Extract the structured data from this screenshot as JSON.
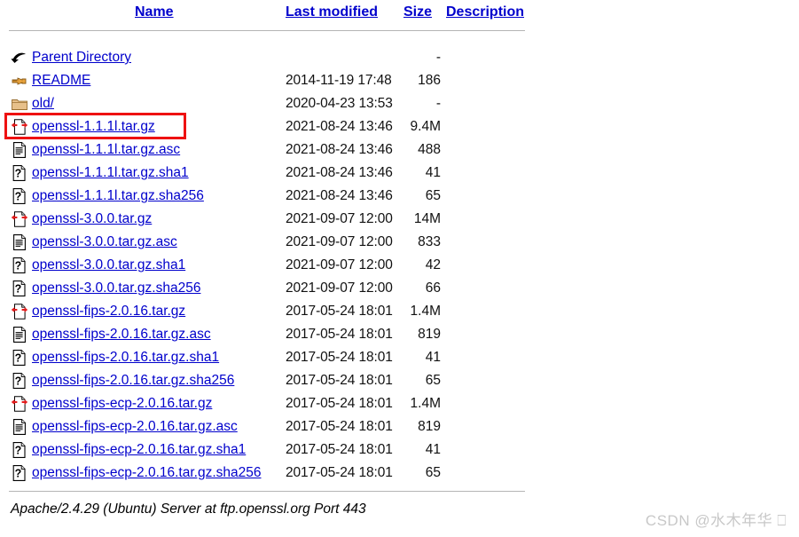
{
  "page": {
    "background": "#ffffff",
    "link_color": "#0000cc",
    "highlight_color": "#ee1111"
  },
  "table": {
    "headers": [
      {
        "label": "Name",
        "name": "column-header-name"
      },
      {
        "label": "Last modified",
        "name": "column-header-last-modified"
      },
      {
        "label": "Size",
        "name": "column-header-size"
      },
      {
        "label": "Description",
        "name": "column-header-description"
      }
    ],
    "rows": [
      {
        "icon": "back-arrow-icon",
        "name": "Parent Directory",
        "modified": "",
        "size": "-",
        "description": ""
      },
      {
        "icon": "hand-pointing-icon",
        "name": "README",
        "modified": "2014-11-19 17:48",
        "size": "186",
        "description": ""
      },
      {
        "icon": "folder-icon",
        "name": "old/",
        "modified": "2020-04-23 13:53",
        "size": "-",
        "description": ""
      },
      {
        "icon": "compressed-icon",
        "name": "openssl-1.1.1l.tar.gz",
        "modified": "2021-08-24 13:46",
        "size": "9.4M",
        "description": "",
        "highlighted": true
      },
      {
        "icon": "text-file-icon",
        "name": "openssl-1.1.1l.tar.gz.asc",
        "modified": "2021-08-24 13:46",
        "size": "488",
        "description": ""
      },
      {
        "icon": "unknown-file-icon",
        "name": "openssl-1.1.1l.tar.gz.sha1",
        "modified": "2021-08-24 13:46",
        "size": "41",
        "description": ""
      },
      {
        "icon": "unknown-file-icon",
        "name": "openssl-1.1.1l.tar.gz.sha256",
        "modified": "2021-08-24 13:46",
        "size": "65",
        "description": ""
      },
      {
        "icon": "compressed-icon",
        "name": "openssl-3.0.0.tar.gz",
        "modified": "2021-09-07 12:00",
        "size": "14M",
        "description": ""
      },
      {
        "icon": "text-file-icon",
        "name": "openssl-3.0.0.tar.gz.asc",
        "modified": "2021-09-07 12:00",
        "size": "833",
        "description": ""
      },
      {
        "icon": "unknown-file-icon",
        "name": "openssl-3.0.0.tar.gz.sha1",
        "modified": "2021-09-07 12:00",
        "size": "42",
        "description": ""
      },
      {
        "icon": "unknown-file-icon",
        "name": "openssl-3.0.0.tar.gz.sha256",
        "modified": "2021-09-07 12:00",
        "size": "66",
        "description": ""
      },
      {
        "icon": "compressed-icon",
        "name": "openssl-fips-2.0.16.tar.gz",
        "modified": "2017-05-24 18:01",
        "size": "1.4M",
        "description": ""
      },
      {
        "icon": "text-file-icon",
        "name": "openssl-fips-2.0.16.tar.gz.asc",
        "modified": "2017-05-24 18:01",
        "size": "819",
        "description": ""
      },
      {
        "icon": "unknown-file-icon",
        "name": "openssl-fips-2.0.16.tar.gz.sha1",
        "modified": "2017-05-24 18:01",
        "size": "41",
        "description": ""
      },
      {
        "icon": "unknown-file-icon",
        "name": "openssl-fips-2.0.16.tar.gz.sha256",
        "modified": "2017-05-24 18:01",
        "size": "65",
        "description": ""
      },
      {
        "icon": "compressed-icon",
        "name": "openssl-fips-ecp-2.0.16.tar.gz",
        "modified": "2017-05-24 18:01",
        "size": "1.4M",
        "description": ""
      },
      {
        "icon": "text-file-icon",
        "name": "openssl-fips-ecp-2.0.16.tar.gz.asc",
        "modified": "2017-05-24 18:01",
        "size": "819",
        "description": ""
      },
      {
        "icon": "unknown-file-icon",
        "name": "openssl-fips-ecp-2.0.16.tar.gz.sha1",
        "modified": "2017-05-24 18:01",
        "size": "41",
        "description": ""
      },
      {
        "icon": "unknown-file-icon",
        "name": "openssl-fips-ecp-2.0.16.tar.gz.sha256",
        "modified": "2017-05-24 18:01",
        "size": "65",
        "description": ""
      }
    ]
  },
  "footer": {
    "text": "Apache/2.4.29 (Ubuntu) Server at ftp.openssl.org Port 443"
  },
  "watermark": {
    "text": "CSDN @水木年华 ⎕"
  }
}
